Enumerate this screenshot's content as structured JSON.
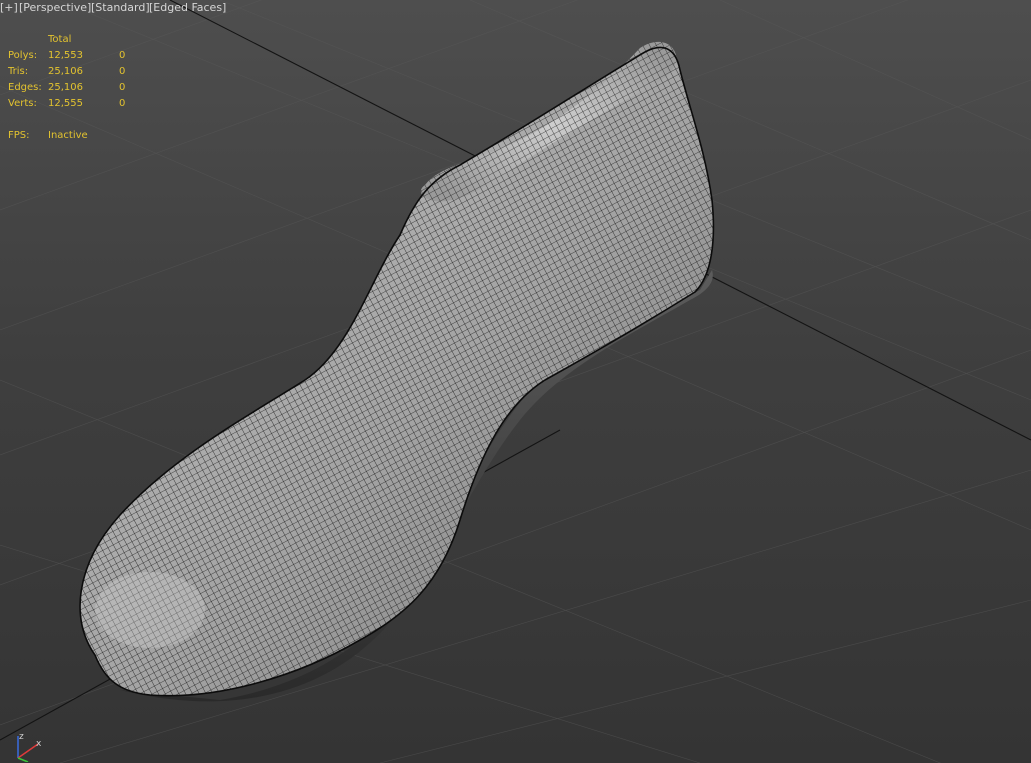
{
  "viewport": {
    "label_plus": "[+]",
    "label_view": "[Perspective]",
    "label_shading": "[Standard]",
    "label_edged": "[Edged Faces]"
  },
  "stats": {
    "header_total": "Total",
    "rows": [
      {
        "label": "Polys:",
        "total": "12,553",
        "selected": "0"
      },
      {
        "label": "Tris:",
        "total": "25,106",
        "selected": "0"
      },
      {
        "label": "Edges:",
        "total": "25,106",
        "selected": "0"
      },
      {
        "label": "Verts:",
        "total": "12,555",
        "selected": "0"
      }
    ],
    "fps_label": "FPS:",
    "fps_value": "Inactive"
  },
  "gizmo": {
    "z_label": "z",
    "x_label": "x"
  },
  "colors": {
    "stats_text": "#e3c32f",
    "mesh_fill": "#a9a9a9",
    "wire": "#111111",
    "grid_major": "#141414",
    "grid_minor": "#5a5a5a",
    "axis_z": "#3a6de0",
    "axis_x": "#e03a3a",
    "axis_y": "#3ac43a"
  },
  "icons": [
    "axis-gizmo-icon"
  ]
}
